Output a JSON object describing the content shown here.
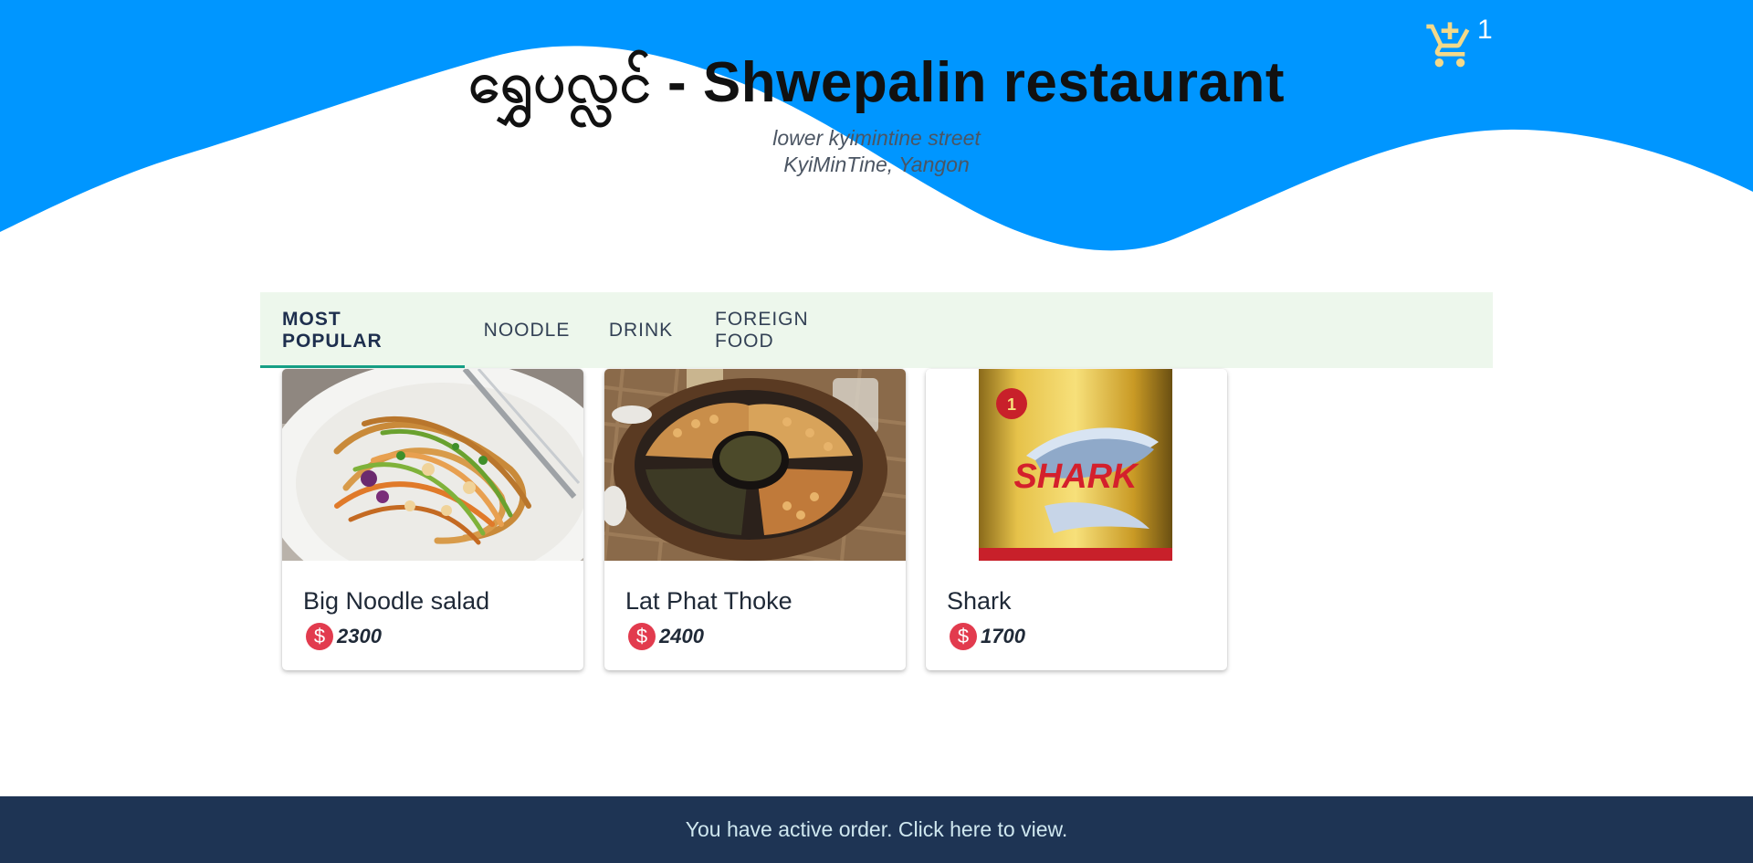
{
  "header": {
    "title": "ရွှေပလ္လင် - Shwepalin restaurant",
    "address_line1": "lower kyimintine street",
    "address_line2": "KyiMinTine, Yangon",
    "background_color": "#0096ff"
  },
  "cart": {
    "icon": "cart-plus-icon",
    "count": "1",
    "icon_color": "#f3d98a"
  },
  "tabs": [
    {
      "label": "MOST POPULAR",
      "active": true
    },
    {
      "label": "NOODLE",
      "active": false
    },
    {
      "label": "DRINK",
      "active": false
    },
    {
      "label": "FOREIGN FOOD",
      "active": false
    }
  ],
  "menu_items": [
    {
      "name": "Big Noodle salad",
      "price": "2300",
      "image": "noodle-salad-photo"
    },
    {
      "name": "Lat Phat Thoke",
      "price": "2400",
      "image": "tea-leaf-salad-photo"
    },
    {
      "name": "Shark",
      "price": "1700",
      "image": "shark-energy-drink-can-photo"
    }
  ],
  "currency_icon": "dollar-coin-icon",
  "currency_symbol": "$",
  "footer": {
    "text": "You have active order. Click here to view."
  },
  "colors": {
    "tabs_background": "#edf7ec",
    "active_tab_indicator": "#16a085",
    "price_badge": "#e23b4e",
    "footer_background": "#1e3454"
  }
}
